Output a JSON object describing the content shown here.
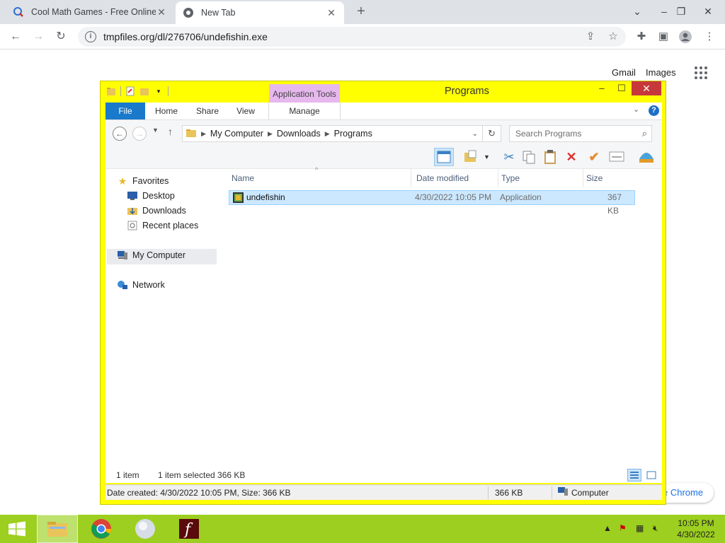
{
  "browser": {
    "tabs": [
      {
        "title": "Cool Math Games - Free Online M",
        "active": false
      },
      {
        "title": "New Tab",
        "active": true
      }
    ],
    "url": "tmpfiles.org/dl/276706/undefishin.exe",
    "ntp": {
      "gmail": "Gmail",
      "images": "Images",
      "customize": "e Chrome"
    }
  },
  "explorer": {
    "context_tab": "Application Tools",
    "title": "Programs",
    "ribbon_tabs": [
      "File",
      "Home",
      "Share",
      "View",
      "Manage"
    ],
    "breadcrumb": [
      "My Computer",
      "Downloads",
      "Programs"
    ],
    "search_placeholder": "Search Programs",
    "nav": {
      "favorites": "Favorites",
      "desktop": "Desktop",
      "downloads": "Downloads",
      "recent": "Recent places",
      "computer": "My Computer",
      "network": "Network"
    },
    "columns": [
      "Name",
      "Date modified",
      "Type",
      "Size"
    ],
    "files": [
      {
        "name": "undefishin",
        "date": "4/30/2022 10:05 PM",
        "type": "Application",
        "size": "367 KB"
      }
    ],
    "status": {
      "count": "1 item",
      "selected": "1 item selected  366 KB"
    },
    "details": {
      "info": "Date created: 4/30/2022 10:05 PM, Size: 366 KB",
      "size": "366 KB",
      "location": "Computer"
    }
  },
  "taskbar": {
    "time": "10:05 PM",
    "date": "4/30/2022"
  },
  "colors": {
    "window_frame": "#ffff00",
    "taskbar": "#9ccf1f",
    "selection": "#cce8ff",
    "close": "#c7383b",
    "file_tab": "#1979ca"
  }
}
